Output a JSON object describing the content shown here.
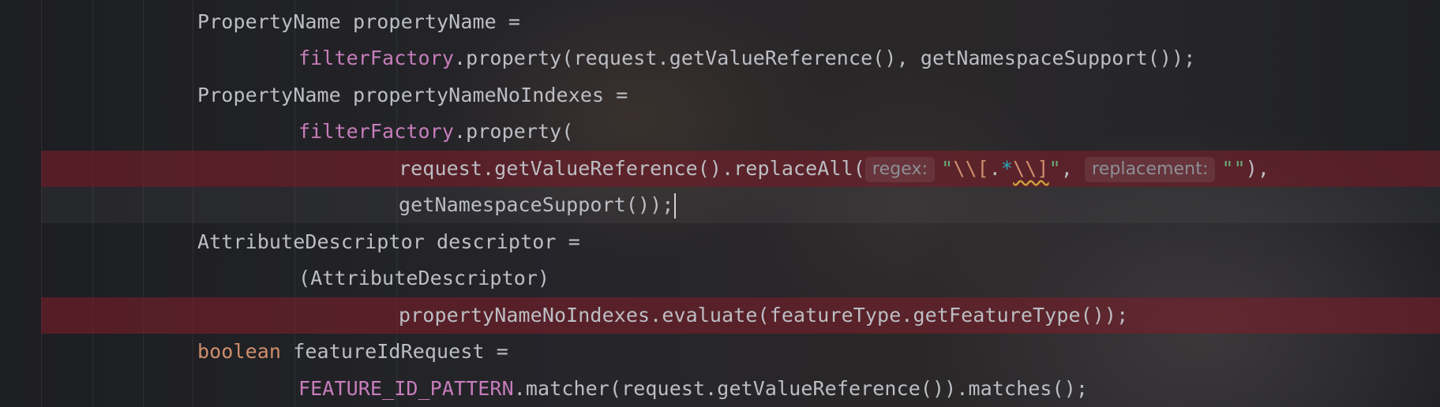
{
  "editor": {
    "lines": [
      {
        "indent": 0,
        "text": "PropertyName propertyName ="
      },
      {
        "indent": 1,
        "field": "filterFactory",
        "rest": ".property(request.getValueReference(), getNamespaceSupport());"
      },
      {
        "indent": 0,
        "text": "PropertyName propertyNameNoIndexes ="
      },
      {
        "indent": 1,
        "field": "filterFactory",
        "rest": ".property("
      },
      {
        "indent": 2,
        "pre": "request.getValueReference().replaceAll(",
        "hint_regex": "regex:",
        "str_open": "\"",
        "esc1": "\\\\[",
        "dot": ".",
        "star": "*",
        "esc2": "\\\\]",
        "str_close": "\"",
        "sep": ", ",
        "hint_replacement": "replacement:",
        "str_empty": "\"\"",
        "post": "),"
      },
      {
        "indent": 2,
        "text": "getNamespaceSupport());"
      },
      {
        "indent": 0,
        "text": "AttributeDescriptor descriptor ="
      },
      {
        "indent": 1,
        "text": "(AttributeDescriptor)"
      },
      {
        "indent": 2,
        "text": "propertyNameNoIndexes.evaluate(featureType.getFeatureType());"
      },
      {
        "indent": 0,
        "keyword": "boolean",
        "rest": " featureIdRequest ="
      },
      {
        "indent": 1,
        "field": "FEATURE_ID_PATTERN",
        "rest": ".matcher(request.getValueReference()).matches();"
      }
    ]
  },
  "colors": {
    "default_text": "#bcbec4",
    "field": "#c77dbb",
    "keyword": "#cf8e6d",
    "string": "#6aab73",
    "regex_meta": "#2aacb8",
    "error_line_highlight": "#782a2e",
    "inlay_hint": "#8c8f96"
  }
}
